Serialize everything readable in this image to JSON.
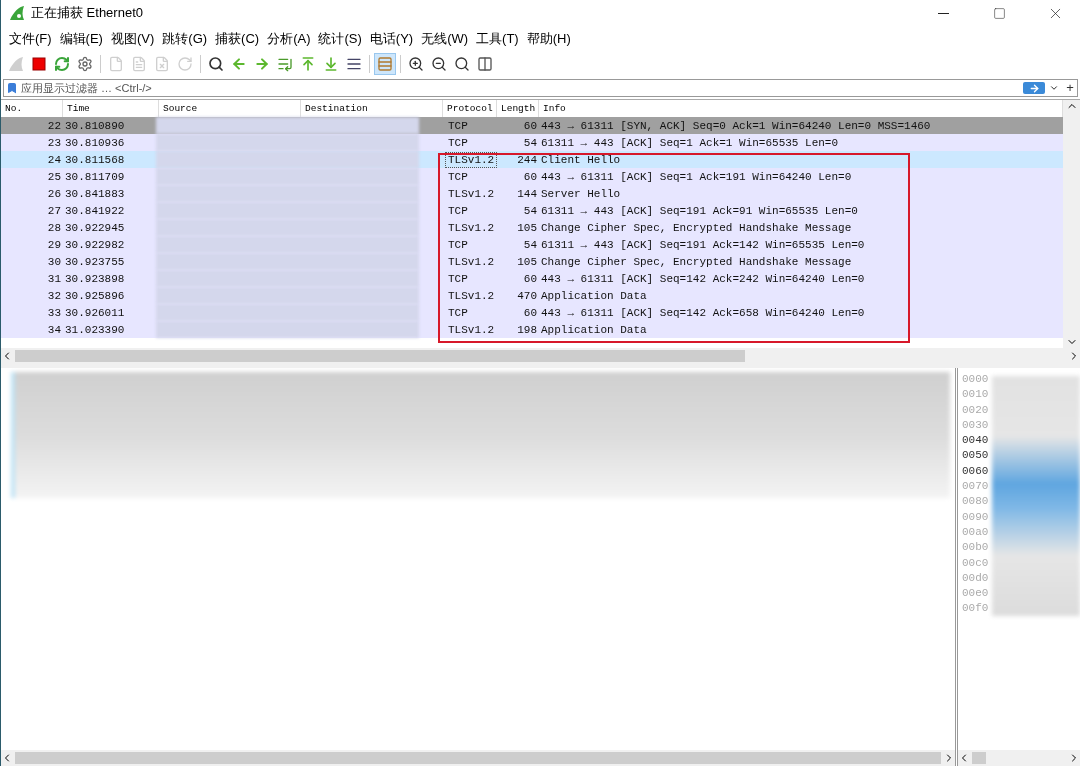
{
  "window": {
    "title": "正在捕获 Ethernet0"
  },
  "menu": [
    {
      "label": "文件(F)"
    },
    {
      "label": "编辑(E)"
    },
    {
      "label": "视图(V)"
    },
    {
      "label": "跳转(G)"
    },
    {
      "label": "捕获(C)"
    },
    {
      "label": "分析(A)"
    },
    {
      "label": "统计(S)"
    },
    {
      "label": "电话(Y)"
    },
    {
      "label": "无线(W)"
    },
    {
      "label": "工具(T)"
    },
    {
      "label": "帮助(H)"
    }
  ],
  "toolbar": [
    {
      "disabled": true,
      "selected": false
    },
    {
      "disabled": false,
      "selected": false
    },
    {
      "disabled": false,
      "selected": false
    },
    {
      "disabled": false,
      "selected": false
    },
    {
      "disabled": true,
      "selected": false
    },
    {
      "disabled": true,
      "selected": false
    },
    {
      "disabled": true,
      "selected": false
    },
    {
      "disabled": true,
      "selected": false
    },
    {
      "disabled": false,
      "selected": false
    },
    {
      "disabled": false,
      "selected": false
    },
    {
      "disabled": false,
      "selected": false
    },
    {
      "disabled": false,
      "selected": false
    },
    {
      "disabled": false,
      "selected": false
    },
    {
      "disabled": false,
      "selected": false
    },
    {
      "disabled": false,
      "selected": false
    },
    {
      "disabled": false,
      "selected": true
    },
    {
      "disabled": false,
      "selected": false
    },
    {
      "disabled": false,
      "selected": false
    },
    {
      "disabled": false,
      "selected": false
    },
    {
      "disabled": false,
      "selected": false
    }
  ],
  "filter": {
    "placeholder": "应用显示过滤器 … <Ctrl-/>",
    "add_label": "+"
  },
  "packet_list": {
    "columns": [
      "No.",
      "Time",
      "Source",
      "Destination",
      "Protocol",
      "Length",
      "Info"
    ],
    "rows": [
      {
        "no": "22",
        "time": "30.810890",
        "protocol": "TCP",
        "length": "60",
        "info": "443 → 61311 [SYN, ACK] Seq=0 Ack=1 Win=64240 Len=0 MSS=1460",
        "color": "#a0a0a0",
        "selected": false
      },
      {
        "no": "23",
        "time": "30.810936",
        "protocol": "TCP",
        "length": "54",
        "info": "61311 → 443 [ACK] Seq=1 Ack=1 Win=65535 Len=0",
        "color": "#e7e6ff",
        "selected": false
      },
      {
        "no": "24",
        "time": "30.811568",
        "protocol": "TLSv1.2",
        "length": "244",
        "info": "Client Hello",
        "selected": true
      },
      {
        "no": "25",
        "time": "30.811709",
        "protocol": "TCP",
        "length": "60",
        "info": "443 → 61311 [ACK] Seq=1 Ack=191 Win=64240 Len=0",
        "color": "#e7e6ff",
        "selected": false
      },
      {
        "no": "26",
        "time": "30.841883",
        "protocol": "TLSv1.2",
        "length": "144",
        "info": "Server Hello",
        "color": "#e7e6ff",
        "selected": false
      },
      {
        "no": "27",
        "time": "30.841922",
        "protocol": "TCP",
        "length": "54",
        "info": "61311 → 443 [ACK] Seq=191 Ack=91 Win=65535 Len=0",
        "color": "#e7e6ff",
        "selected": false
      },
      {
        "no": "28",
        "time": "30.922945",
        "protocol": "TLSv1.2",
        "length": "105",
        "info": "Change Cipher Spec, Encrypted Handshake Message",
        "color": "#e7e6ff",
        "selected": false
      },
      {
        "no": "29",
        "time": "30.922982",
        "protocol": "TCP",
        "length": "54",
        "info": "61311 → 443 [ACK] Seq=191 Ack=142 Win=65535 Len=0",
        "color": "#e7e6ff",
        "selected": false
      },
      {
        "no": "30",
        "time": "30.923755",
        "protocol": "TLSv1.2",
        "length": "105",
        "info": "Change Cipher Spec, Encrypted Handshake Message",
        "color": "#e7e6ff",
        "selected": false
      },
      {
        "no": "31",
        "time": "30.923898",
        "protocol": "TCP",
        "length": "60",
        "info": "443 → 61311 [ACK] Seq=142 Ack=242 Win=64240 Len=0",
        "color": "#e7e6ff",
        "selected": false
      },
      {
        "no": "32",
        "time": "30.925896",
        "protocol": "TLSv1.2",
        "length": "470",
        "info": "Application Data",
        "color": "#e7e6ff",
        "selected": false
      },
      {
        "no": "33",
        "time": "30.926011",
        "protocol": "TCP",
        "length": "60",
        "info": "443 → 61311 [ACK] Seq=142 Ack=658 Win=64240 Len=0",
        "color": "#e7e6ff",
        "selected": false
      },
      {
        "no": "34",
        "time": "31.023390",
        "protocol": "TLSv1.2",
        "length": "198",
        "info": "Application Data",
        "color": "#e7e6ff",
        "selected": false
      }
    ]
  },
  "bytes": {
    "offsets": [
      {
        "text": "0000",
        "highlighted": false
      },
      {
        "text": "0010",
        "highlighted": false
      },
      {
        "text": "0020",
        "highlighted": false
      },
      {
        "text": "0030",
        "highlighted": false
      },
      {
        "text": "0040",
        "highlighted": true
      },
      {
        "text": "0050",
        "highlighted": true
      },
      {
        "text": "0060",
        "highlighted": true
      },
      {
        "text": "0070",
        "highlighted": false
      },
      {
        "text": "0080",
        "highlighted": false
      },
      {
        "text": "0090",
        "highlighted": false
      },
      {
        "text": "00a0",
        "highlighted": false
      },
      {
        "text": "00b0",
        "highlighted": false
      },
      {
        "text": "00c0",
        "highlighted": false
      },
      {
        "text": "00d0",
        "highlighted": false
      },
      {
        "text": "00e0",
        "highlighted": false
      },
      {
        "text": "00f0",
        "highlighted": false
      }
    ]
  }
}
